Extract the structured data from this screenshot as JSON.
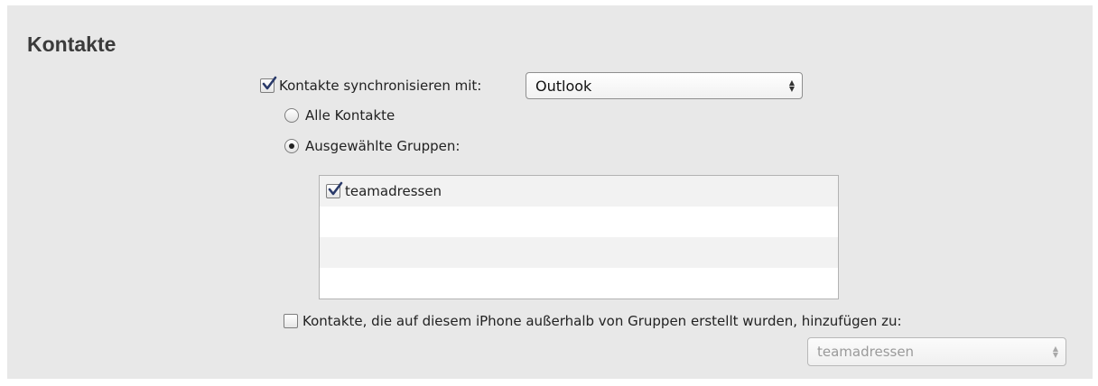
{
  "section": {
    "title": "Kontakte"
  },
  "sync": {
    "label": "Kontakte synchronisieren mit:",
    "checked": true,
    "source_selected": "Outlook"
  },
  "options": {
    "all_label": "Alle Kontakte",
    "selected_groups_label": "Ausgewählte Gruppen:",
    "selected": "selected_groups"
  },
  "groups": [
    {
      "label": "teamadressen",
      "checked": true
    }
  ],
  "add_outside": {
    "label": "Kontakte, die auf diesem iPhone außerhalb von Gruppen erstellt wurden, hinzufügen zu:",
    "checked": false,
    "target_selected": "teamadressen"
  },
  "icons": {
    "checkmark": "checkmark-icon",
    "select_arrows": "updown-arrows-icon"
  },
  "colors": {
    "panel_bg": "#e8e8e8",
    "checkmark": "#2a3a6a"
  }
}
